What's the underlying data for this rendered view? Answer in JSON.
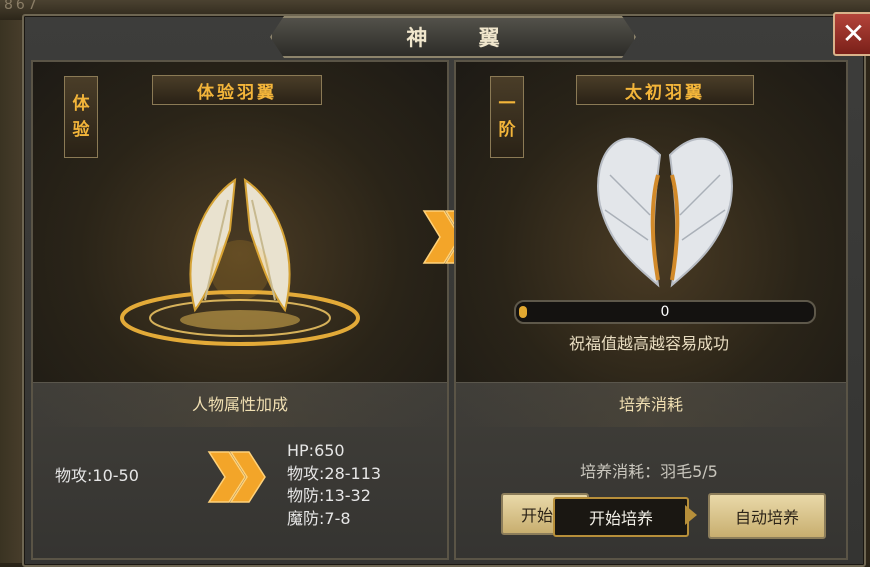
{
  "background": {
    "number": "867"
  },
  "window": {
    "title": "神 翼"
  },
  "left": {
    "side_tag": [
      "体",
      "验"
    ],
    "wing_name": "体验羽翼",
    "section_title": "人物属性加成",
    "base_stat": "物攻:10-50",
    "upgraded_stats": [
      "HP:650",
      "物攻:28-113",
      "物防:13-32",
      "魔防:7-8"
    ]
  },
  "right": {
    "side_tag": [
      "一",
      "阶"
    ],
    "wing_name": "太初羽翼",
    "progress_value": "0",
    "progress_fraction": 0,
    "hint": "祝福值越高越容易成功",
    "section_title": "培养消耗",
    "cost_text": "培养消耗：羽毛5/5",
    "start_button": "开始培",
    "tooltip": "开始培养",
    "auto_button": "自动培养"
  },
  "colors": {
    "accent_gold": "#f3b53a",
    "close_red": "#b4443a",
    "panel_gray": "#3d3d3b"
  },
  "icons": {
    "close": "close-icon",
    "arrow": "double-chevron-right-icon"
  }
}
